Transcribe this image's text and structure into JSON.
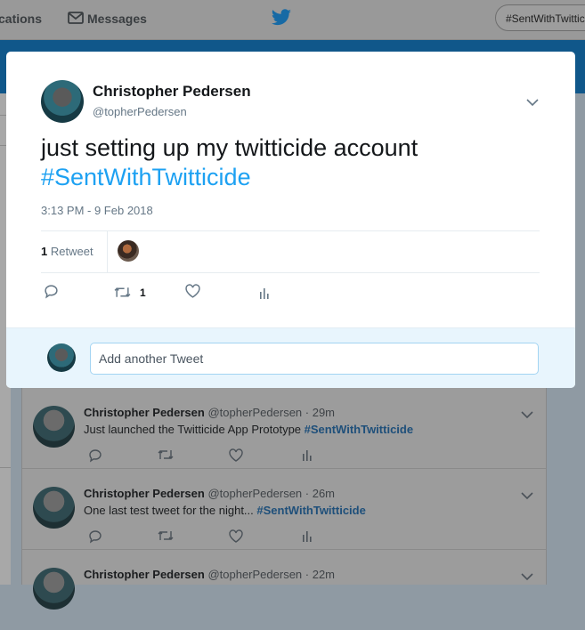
{
  "topnav": {
    "notifications_label": "cations",
    "messages_label": "Messages",
    "search_value": "#SentWithTwitticide"
  },
  "modal": {
    "author_name": "Christopher Pedersen",
    "author_handle": "@topherPedersen",
    "tweet_text": "just setting up my twitticide account",
    "tweet_hashtag": "#SentWithTwitticide",
    "timestamp": "3:13 PM - 9 Feb 2018",
    "retweet_count": "1",
    "retweet_label": "Retweet",
    "retweet_action_count": "1",
    "reply_placeholder": "Add another Tweet"
  },
  "timeline": [
    {
      "name": "Christopher Pedersen",
      "handle_time": "@topherPedersen · 29m",
      "text": "Just launched the Twitticide App Prototype",
      "hashtag": "#SentWithTwitticide"
    },
    {
      "name": "Christopher Pedersen",
      "handle_time": "@topherPedersen · 26m",
      "text": "One last test tweet for the night...",
      "hashtag": "#SentWithTwitticide"
    },
    {
      "name": "Christopher Pedersen",
      "handle_time": "@topherPedersen · 22m",
      "text": "",
      "hashtag": ""
    }
  ],
  "colors": {
    "accent": "#1da1f2",
    "overlay": "#8f9aa3",
    "header_band": "#10578a"
  },
  "icons": [
    "mail-icon",
    "twitter-bird-icon",
    "chevron-down-icon",
    "reply-icon",
    "retweet-icon",
    "like-icon",
    "analytics-icon"
  ]
}
